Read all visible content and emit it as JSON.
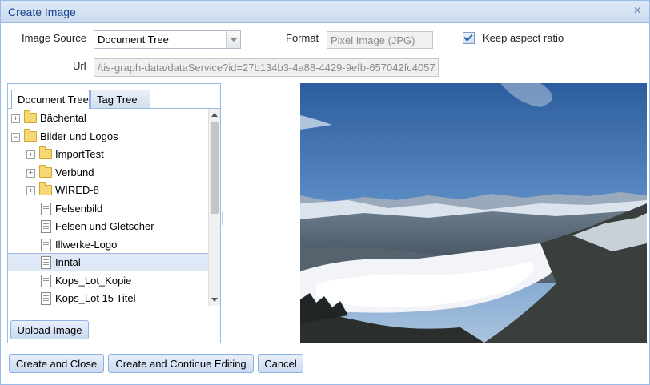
{
  "dialog": {
    "title": "Create Image",
    "close_icon": "close-icon"
  },
  "form": {
    "image_source_label": "Image Source",
    "image_source_value": "Document Tree",
    "format_label": "Format",
    "format_value": "Pixel Image (JPG)",
    "keep_aspect_ratio_label": "Keep aspect ratio",
    "keep_aspect_ratio_checked": true,
    "url_label": "Url",
    "url_value": "/tis-graph-data/dataService?id=27b134b3-4a88-4429-9efb-657042fc4057"
  },
  "tabs": [
    {
      "label": "Document Tree",
      "active": true
    },
    {
      "label": "Tag Tree",
      "active": false
    }
  ],
  "tree": [
    {
      "label": "Bächental",
      "type": "folder",
      "expander": "+"
    },
    {
      "label": "Bilder und Logos",
      "type": "folder",
      "expander": "−"
    },
    {
      "label": "ImportTest",
      "type": "folder",
      "expander": "+"
    },
    {
      "label": "Verbund",
      "type": "folder",
      "expander": "+"
    },
    {
      "label": "WIRED-8",
      "type": "folder",
      "expander": "+"
    },
    {
      "label": "Felsenbild",
      "type": "document"
    },
    {
      "label": "Felsen und Gletscher",
      "type": "document"
    },
    {
      "label": "Illwerke-Logo",
      "type": "document"
    },
    {
      "label": "Inntal",
      "type": "document",
      "selected": true
    },
    {
      "label": "Kops_Lot_Kopie",
      "type": "document"
    },
    {
      "label": "Kops_Lot 15 Titel",
      "type": "document"
    }
  ],
  "buttons": {
    "upload_image": "Upload Image",
    "create_and_close": "Create and Close",
    "create_and_continue": "Create and Continue Editing",
    "cancel": "Cancel"
  },
  "colors": {
    "accent": "#15428b",
    "border": "#99bbe8",
    "selection": "#dfe8f6"
  }
}
